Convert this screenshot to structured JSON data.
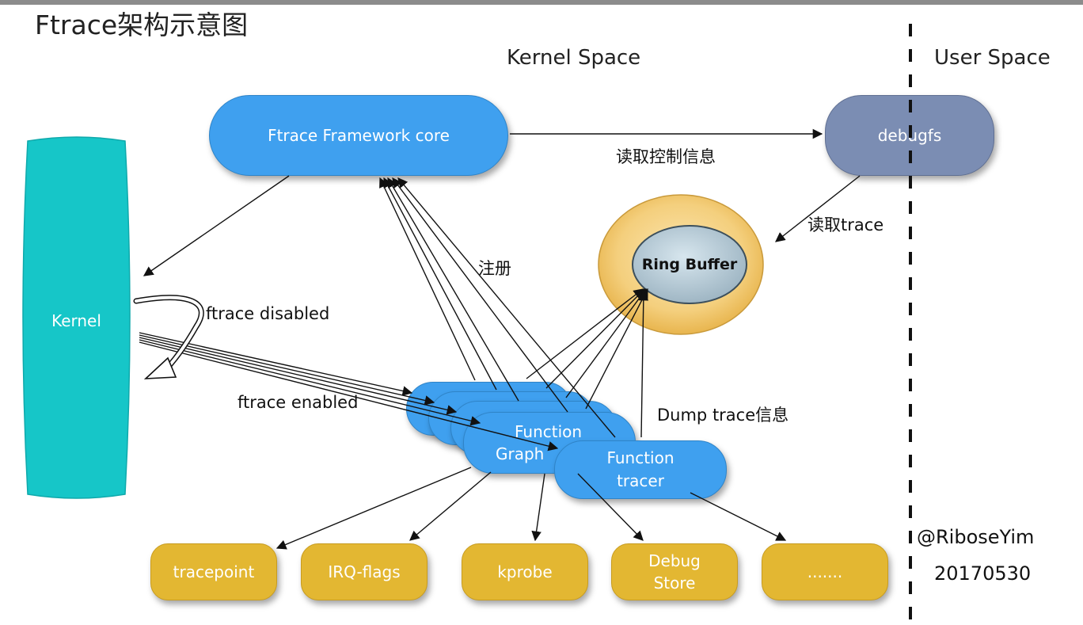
{
  "title": "Ftrace架构示意图",
  "regions": {
    "kernel_space": "Kernel Space",
    "user_space": "User Space"
  },
  "nodes": {
    "ftrace_core": "Ftrace Framework core",
    "debugfs": "debugfs",
    "kernel": "Kernel",
    "ring_buffer": "Ring Buffer",
    "graph_tracer_line1": "Function",
    "graph_tracer_line2": "Graph",
    "function_tracer_line1": "Function",
    "function_tracer_line2": "tracer",
    "tracepoint": "tracepoint",
    "irq_flags": "IRQ-flags",
    "kprobe": "kprobe",
    "debug_store_line1": "Debug",
    "debug_store_line2": "Store",
    "more": "......."
  },
  "edge_labels": {
    "read_control": "读取控制信息",
    "read_trace": "读取trace",
    "register": "注册",
    "ftrace_disabled": "ftrace disabled",
    "ftrace_enabled": "ftrace enabled",
    "dump_trace": "Dump trace信息"
  },
  "credit": {
    "author": "@RiboseYim",
    "date": "20170530"
  },
  "colors": {
    "tracer_blue": "#3fa0ef",
    "debugfs_slate": "#7b8db3",
    "kernel_teal": "#16c6c8",
    "ring_outer": "#f0c36a",
    "ring_inner": "#aec3cf",
    "plugin_yellow": "#e3b732"
  }
}
